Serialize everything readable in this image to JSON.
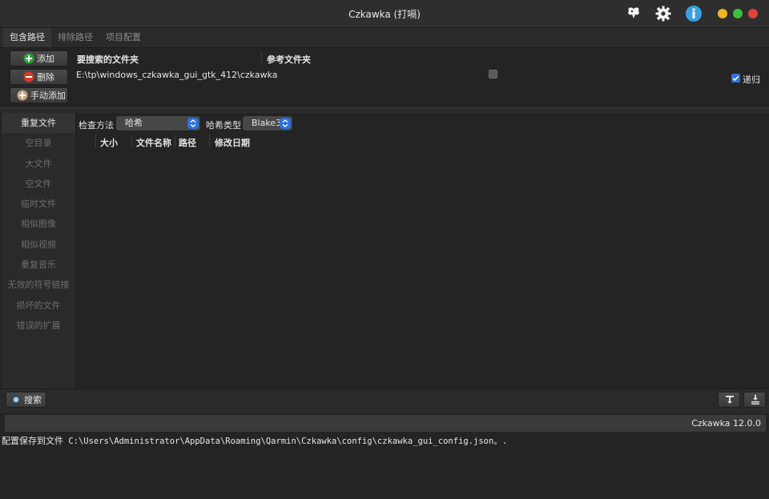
{
  "window": {
    "title": "Czkawka (打嗝)"
  },
  "colors": {
    "accent": "#2f72d8",
    "close": "#e0443e",
    "minimize": "#f0b429",
    "maximize": "#3fbe3f"
  },
  "header_icons": [
    "butterfly-icon",
    "settings-icon",
    "info-icon"
  ],
  "tabs": [
    {
      "label": "包含路径",
      "active": true
    },
    {
      "label": "排除路径",
      "active": false
    },
    {
      "label": "项目配置",
      "active": false
    }
  ],
  "include": {
    "add_label": "添加",
    "remove_label": "删除",
    "manual_add_label": "手动添加",
    "col_search": "要搜索的文件夹",
    "col_reference": "参考文件夹",
    "rows": [
      {
        "path": "E:\\tp\\windows_czkawka_gui_gtk_412\\czkawka",
        "reference": false
      }
    ],
    "recursive_label": "递归",
    "recursive_checked": true
  },
  "sidebar": {
    "items": [
      {
        "label": "重复文件",
        "active": true
      },
      {
        "label": "空目录",
        "active": false
      },
      {
        "label": "大文件",
        "active": false
      },
      {
        "label": "空文件",
        "active": false
      },
      {
        "label": "临时文件",
        "active": false
      },
      {
        "label": "相似图像",
        "active": false
      },
      {
        "label": "相似视频",
        "active": false
      },
      {
        "label": "重复音乐",
        "active": false
      },
      {
        "label": "无效的符号链接",
        "active": false
      },
      {
        "label": "损坏的文件",
        "active": false
      },
      {
        "label": "错误的扩展",
        "active": false
      }
    ]
  },
  "main": {
    "check_method_label": "检查方法",
    "check_method_value": "哈希",
    "hash_type_label": "哈希类型",
    "hash_type_value": "Blake3",
    "columns": [
      "大小",
      "文件名称",
      "路径",
      "修改日期"
    ]
  },
  "bottom": {
    "search_label": "搜索"
  },
  "status": {
    "version": "Czkawka 12.0.0"
  },
  "log": {
    "prefix": "配置保存到文件",
    "path": " C:\\Users\\Administrator\\AppData\\Roaming\\Qarmin\\Czkawka\\config\\czkawka_gui_config.json。."
  }
}
